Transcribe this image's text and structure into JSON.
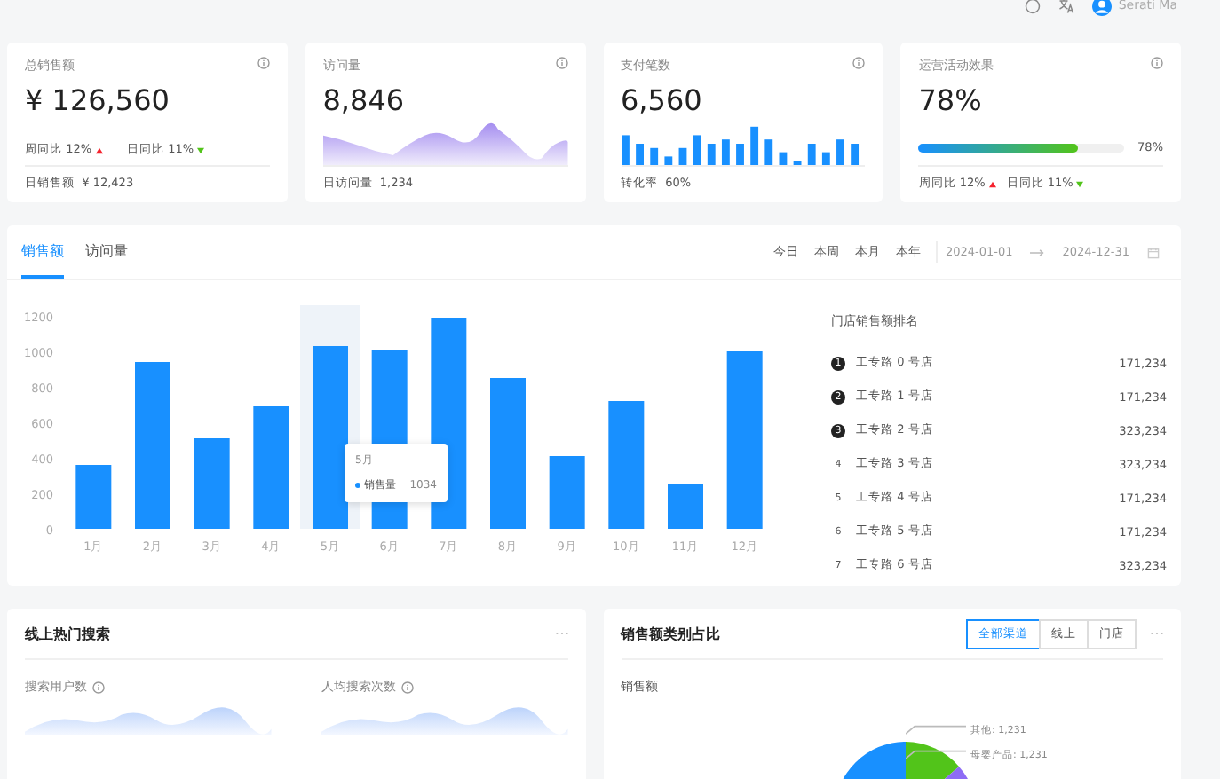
{
  "header": {
    "user": "Serati Ma"
  },
  "stats": [
    {
      "kind": "trend",
      "title": "总销售额",
      "value": "¥ 126,560",
      "trends": [
        {
          "label": "周同比",
          "value": "12%",
          "up": true
        },
        {
          "label": "日同比",
          "value": "11%",
          "up": false
        }
      ],
      "footer_label": "日销售额",
      "footer_value": "¥ 12,423"
    },
    {
      "kind": "area",
      "title": "访问量",
      "value": "8,846",
      "footer_label": "日访问量",
      "footer_value": "1,234"
    },
    {
      "kind": "bars",
      "title": "支付笔数",
      "value": "6,560",
      "footer_label": "转化率",
      "footer_value": "60%"
    },
    {
      "kind": "progress",
      "title": "运营活动效果",
      "value": "78%",
      "level": 0.78,
      "reading": "78%",
      "trends": [
        {
          "label": "周同比",
          "value": "12%",
          "up": true
        },
        {
          "label": "日同比",
          "value": "11%",
          "up": false
        }
      ]
    }
  ],
  "sales": {
    "tabs": [
      {
        "label": "销售额",
        "selected": true
      },
      {
        "label": "访问量",
        "selected": false
      }
    ],
    "ranges": [
      {
        "label": "今日",
        "selected": false
      },
      {
        "label": "本周",
        "selected": false
      },
      {
        "label": "本月",
        "selected": false
      },
      {
        "label": "本年",
        "selected": false
      }
    ],
    "date_start": "2024-01-01",
    "date_end": "2024-12-31",
    "chart_data": {
      "type": "bar",
      "categories": [
        "1月",
        "2月",
        "3月",
        "4月",
        "5月",
        "6月",
        "7月",
        "8月",
        "9月",
        "10月",
        "11月",
        "12月"
      ],
      "values": [
        360,
        940,
        510,
        690,
        1030,
        1010,
        1190,
        850,
        410,
        720,
        250,
        1000
      ],
      "ylim": [
        0,
        1200
      ],
      "yticks": [
        0,
        200,
        400,
        600,
        800,
        1000,
        1200
      ]
    },
    "tooltip": {
      "title": "5月",
      "series": "销售量",
      "value": "1034"
    },
    "ranking": {
      "title": "门店销售额排名",
      "items": [
        {
          "rank": "1",
          "name": "工专路 0 号店",
          "total": "171,234",
          "top": true
        },
        {
          "rank": "2",
          "name": "工专路 1 号店",
          "total": "171,234",
          "top": true
        },
        {
          "rank": "3",
          "name": "工专路 2 号店",
          "total": "323,234",
          "top": true
        },
        {
          "rank": "4",
          "name": "工专路 3 号店",
          "total": "323,234",
          "top": false
        },
        {
          "rank": "5",
          "name": "工专路 4 号店",
          "total": "171,234",
          "top": false
        },
        {
          "rank": "6",
          "name": "工专路 5 号店",
          "total": "171,234",
          "top": false
        },
        {
          "rank": "7",
          "name": "工专路 6 号店",
          "total": "323,234",
          "top": false
        }
      ]
    }
  },
  "search": {
    "title": "线上热门搜索",
    "metrics": [
      "搜索用户数",
      "人均搜索次数"
    ]
  },
  "category": {
    "title": "销售额类别占比",
    "channels": [
      {
        "label": "全部渠道",
        "selected": true
      },
      {
        "label": "线上",
        "selected": false
      },
      {
        "label": "门店",
        "selected": false
      }
    ],
    "subtitle": "销售额",
    "pie_labels": [
      "其他: 1,231",
      "母婴产品: 1,231"
    ]
  }
}
